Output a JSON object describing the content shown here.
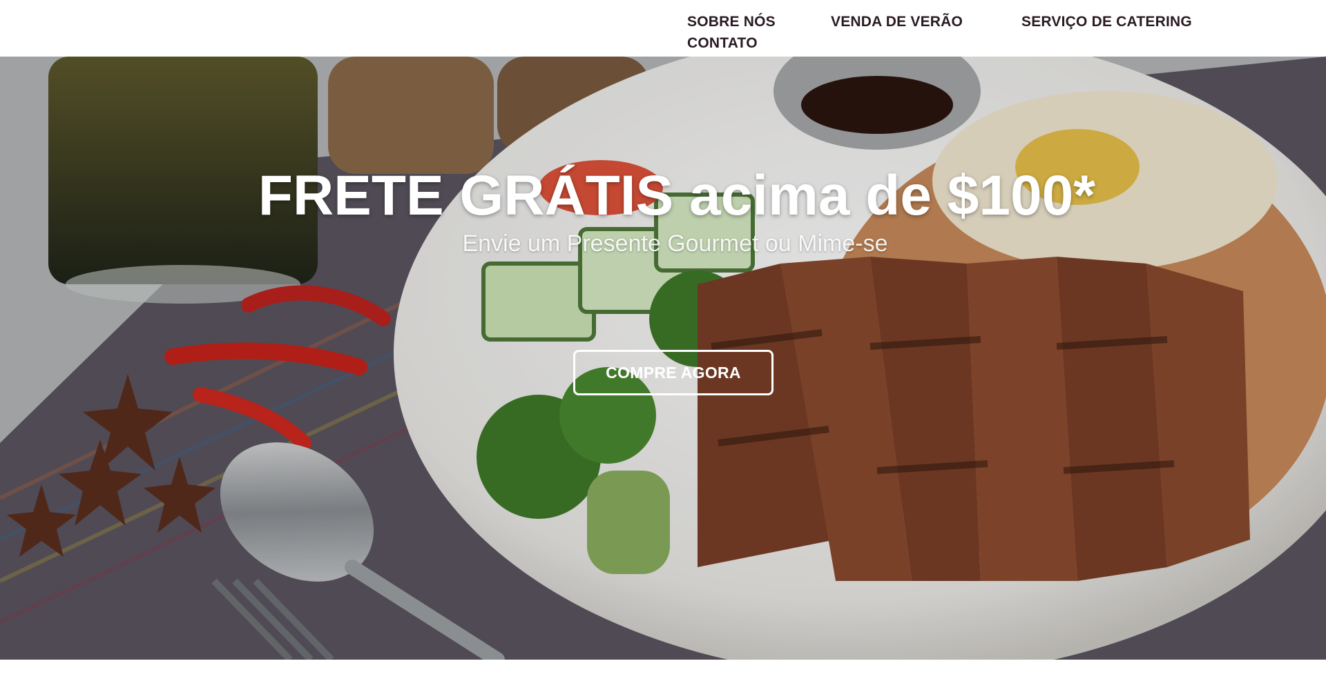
{
  "nav": {
    "items": [
      {
        "label": "SOBRE NÓS"
      },
      {
        "label": "VENDA DE VERÃO"
      },
      {
        "label": "SERVIÇO DE CATERING"
      },
      {
        "label": "CONTATO"
      }
    ]
  },
  "hero": {
    "title": "FRETE GRÁTIS acima de $100*",
    "subtitle": "Envie um Presente Gourmet ou Mime-se",
    "cta_label": "COMPRE AGORA",
    "image_subject": "grilled pork steak with fried rice, broccoli, cucumber, egg and dipping sauce on a white plate"
  },
  "colors": {
    "nav_text": "#2a1a23",
    "hero_text": "#ffffff",
    "plate": "#f4f2ef",
    "meat": "#7a3f28"
  }
}
